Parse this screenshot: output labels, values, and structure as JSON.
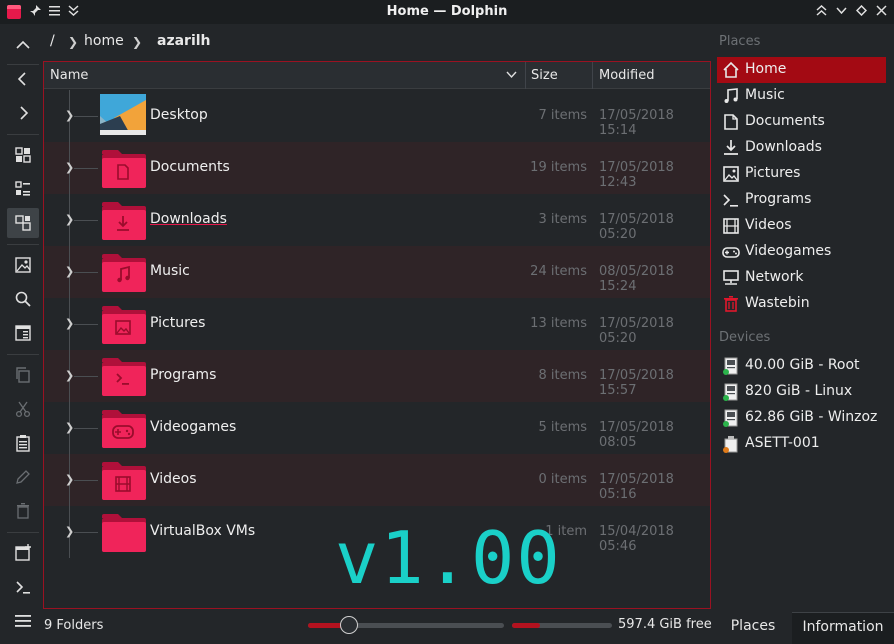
{
  "window": {
    "title": "Home — Dolphin"
  },
  "titlebar": {
    "pin_icon": "pin-icon",
    "menu_icon": "menu-icon",
    "collapse_icon": "chevron-double-icon",
    "keep_above_glyph": "⋀",
    "minimize_glyph": "⌄",
    "maximize_glyph": "◇",
    "close_glyph": "✕"
  },
  "breadcrumb": {
    "root": "/",
    "segments": [
      "home",
      "azarilh"
    ]
  },
  "columns": {
    "name": "Name",
    "size": "Size",
    "modified": "Modified"
  },
  "files": [
    {
      "name": "Desktop",
      "size": "7 items",
      "modified": "17/05/2018 15:14",
      "icon": "desktop-folder-icon"
    },
    {
      "name": "Documents",
      "size": "19 items",
      "modified": "17/05/2018 12:43",
      "icon": "documents-folder-icon"
    },
    {
      "name": "Downloads",
      "size": "3 items",
      "modified": "17/05/2018 05:20",
      "icon": "downloads-folder-icon"
    },
    {
      "name": "Music",
      "size": "24 items",
      "modified": "08/05/2018 15:24",
      "icon": "music-folder-icon"
    },
    {
      "name": "Pictures",
      "size": "13 items",
      "modified": "17/05/2018 05:20",
      "icon": "pictures-folder-icon"
    },
    {
      "name": "Programs",
      "size": "8 items",
      "modified": "17/05/2018 15:57",
      "icon": "programs-folder-icon"
    },
    {
      "name": "Videogames",
      "size": "5 items",
      "modified": "17/05/2018 08:05",
      "icon": "videogames-folder-icon"
    },
    {
      "name": "Videos",
      "size": "0 items",
      "modified": "17/05/2018 05:16",
      "icon": "videos-folder-icon"
    },
    {
      "name": "VirtualBox VMs",
      "size": "1 item",
      "modified": "15/04/2018 05:46",
      "icon": "folder-icon"
    }
  ],
  "places": {
    "places_header": "Places",
    "items": [
      {
        "label": "Home",
        "icon": "home-icon"
      },
      {
        "label": "Music",
        "icon": "music-icon"
      },
      {
        "label": "Documents",
        "icon": "document-icon"
      },
      {
        "label": "Downloads",
        "icon": "download-icon"
      },
      {
        "label": "Pictures",
        "icon": "picture-icon"
      },
      {
        "label": "Programs",
        "icon": "terminal-icon"
      },
      {
        "label": "Videos",
        "icon": "film-icon"
      },
      {
        "label": "Videogames",
        "icon": "gamepad-icon"
      },
      {
        "label": "Network",
        "icon": "network-icon"
      },
      {
        "label": "Wastebin",
        "icon": "trash-icon"
      }
    ],
    "devices_header": "Devices",
    "devices": [
      {
        "label": "40.00 GiB - Root",
        "icon": "drive-icon"
      },
      {
        "label": "820 GiB - Linux",
        "icon": "drive-icon"
      },
      {
        "label": "62.86 GiB - Winzoz",
        "icon": "drive-icon"
      },
      {
        "label": "ASETT-001",
        "icon": "usb-drive-icon"
      }
    ]
  },
  "status": {
    "count": "9 Folders",
    "zoom_level": 0.21,
    "space_used_fraction": 0.28,
    "free_space": "597.4 GiB free"
  },
  "panel_tabs": {
    "places": "Places",
    "information": "Information"
  },
  "watermark": "v1.00",
  "colors": {
    "accent": "#e6194b",
    "selection": "#a30a13",
    "watermark": "#1ad0c8"
  }
}
